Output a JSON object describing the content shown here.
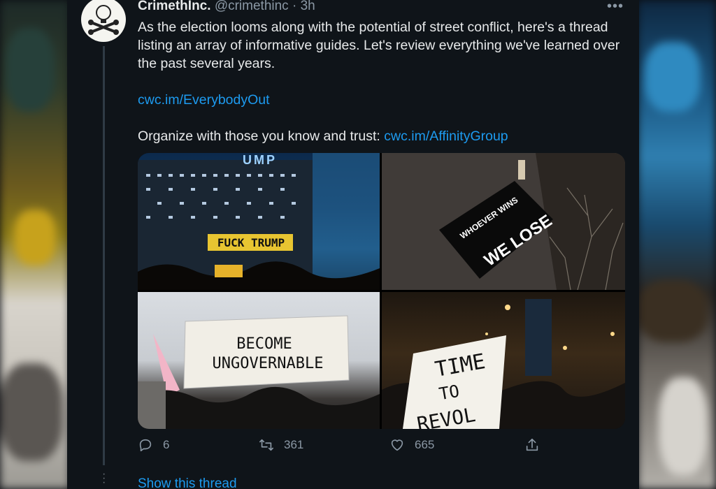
{
  "tweet": {
    "author_name": "CrimethInc.",
    "author_handle": "@crimethinc",
    "separator": "·",
    "time": "3h",
    "more": "•••",
    "paragraph1": "As the election looms along with the potential of street conflict, here's a thread listing an array of informative guides. Let's review everything we've learned over the past several years.",
    "link1": "cwc.im/EverybodyOut",
    "paragraph3_prefix": "Organize with those you know and trust: ",
    "link2": "cwc.im/AffinityGroup",
    "media": {
      "photo1_sign": "FUCK TRUMP",
      "photo1_building": "UMP",
      "photo2_banner_line1": "WHOEVER WINS",
      "photo2_banner_line2": "WE LOSE",
      "photo3_banner_line1": "BECOME",
      "photo3_banner_line2": "UNGOVERNABLE",
      "photo4_sign_line1": "TIME",
      "photo4_sign_line2": "TO",
      "photo4_sign_line3": "REVOL"
    },
    "actions": {
      "replies": "6",
      "retweets": "361",
      "likes": "665"
    },
    "show_thread": "Show this thread"
  },
  "icons": [
    "reply-icon",
    "retweet-icon",
    "like-icon",
    "share-icon",
    "more-icon"
  ],
  "colors": {
    "background": "#0f1419",
    "text": "#e7e9ea",
    "secondary": "#8b98a5",
    "link": "#1d9bf0"
  }
}
